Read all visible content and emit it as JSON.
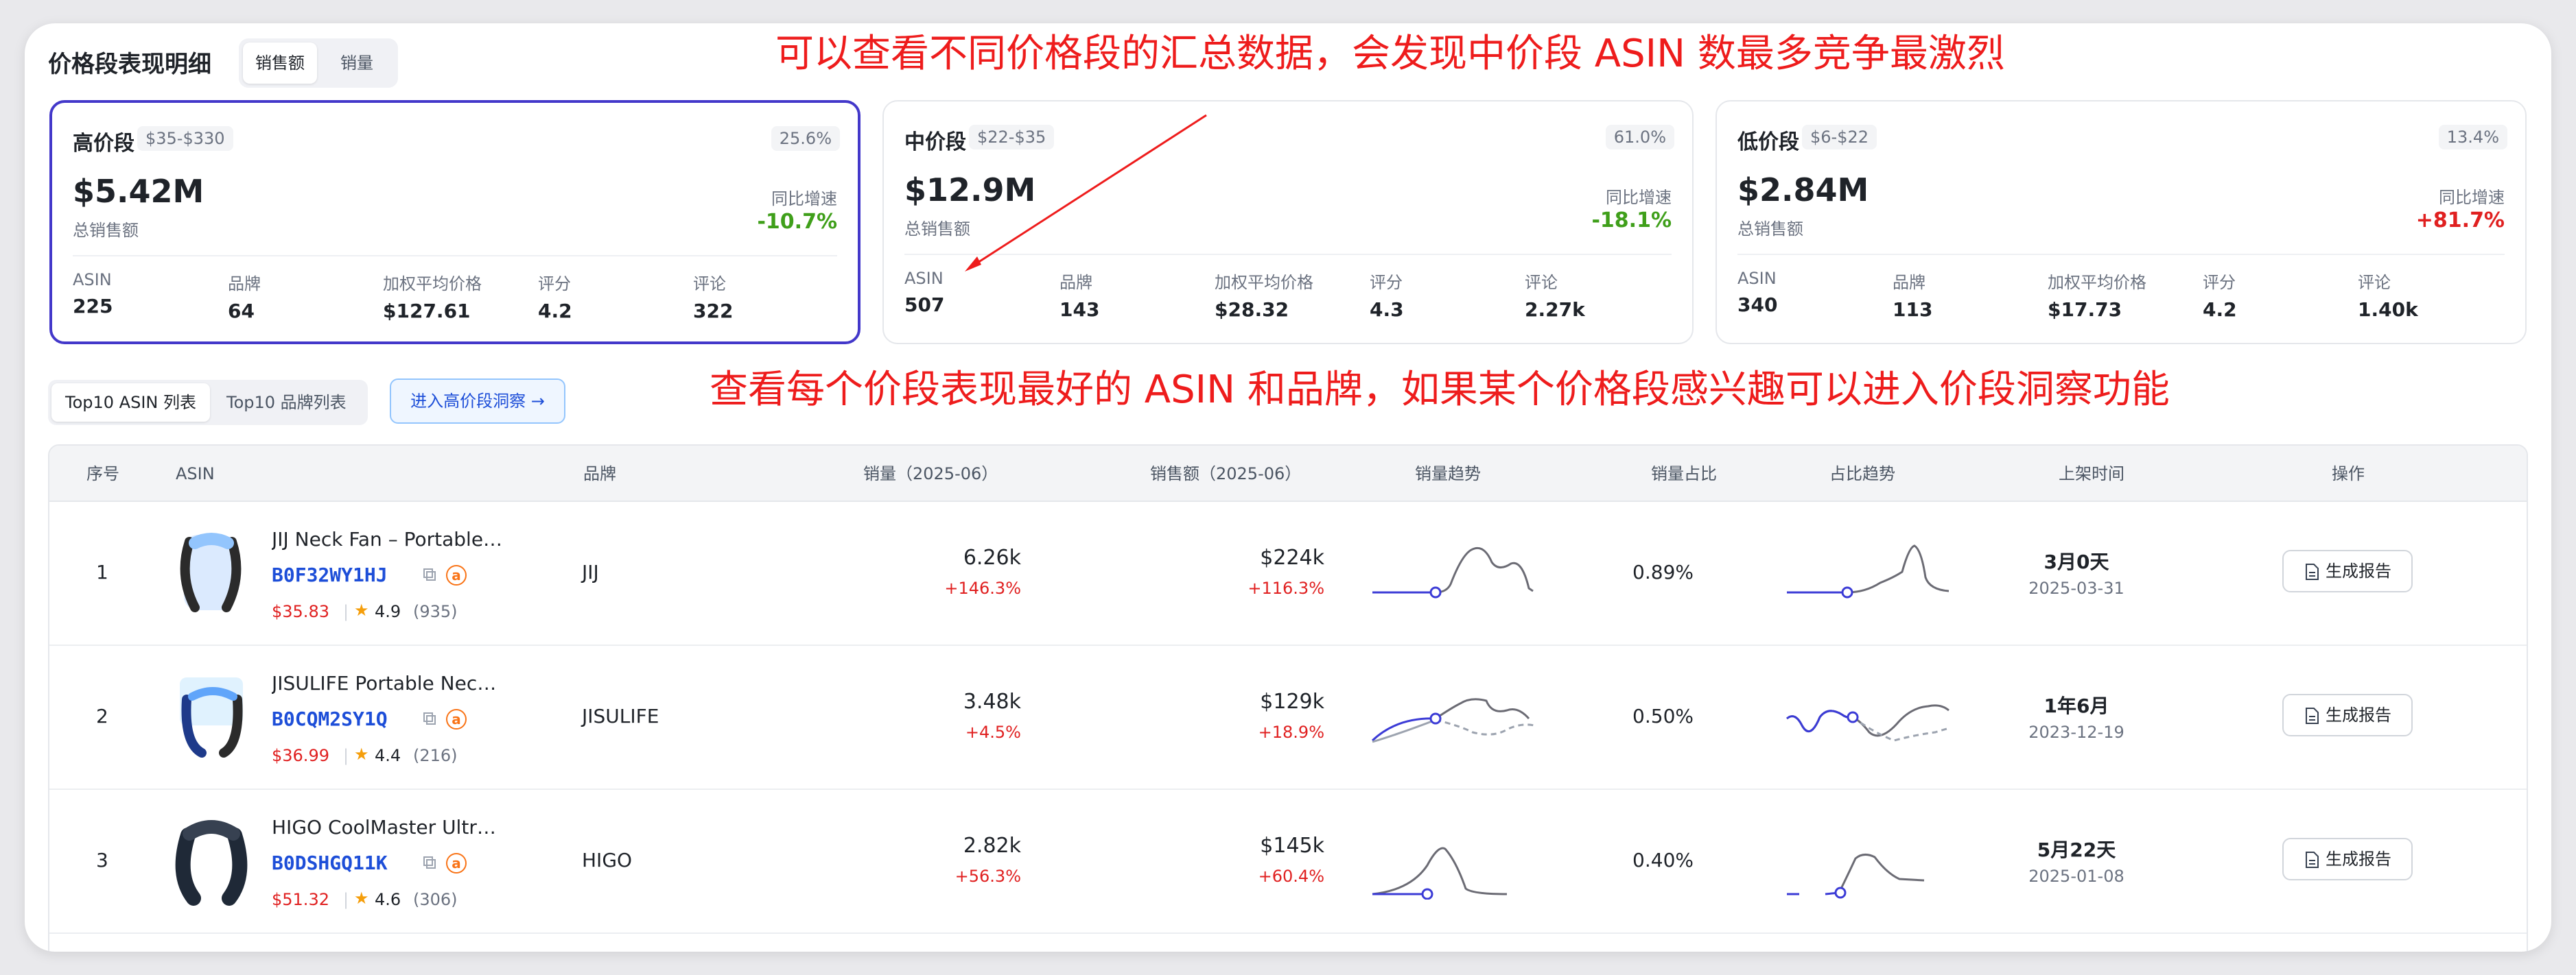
{
  "header": {
    "title": "价格段表现明细",
    "segment": [
      "销售额",
      "销量"
    ]
  },
  "annotations": {
    "top": "可以查看不同价格段的汇总数据，会发现中价段 ASIN 数最多竞争最激烈",
    "middle": "查看每个价段表现最好的 ASIN 和品牌，如果某个价格段感兴趣可以进入价段洞察功能"
  },
  "summary_label": "总销售额",
  "yoy_label": "同比增速",
  "metric_labels": [
    "ASIN",
    "品牌",
    "加权平均价格",
    "评分",
    "评论"
  ],
  "cards": [
    {
      "name": "高价段",
      "range": "$35-$330",
      "share": "25.6%",
      "total": "$5.42M",
      "yoy": "-10.7%",
      "asin": "225",
      "brand": "64",
      "price": "$127.61",
      "rating": "4.2",
      "reviews": "322"
    },
    {
      "name": "中价段",
      "range": "$22-$35",
      "share": "61.0%",
      "total": "$12.9M",
      "yoy": "-18.1%",
      "asin": "507",
      "brand": "143",
      "price": "$28.32",
      "rating": "4.3",
      "reviews": "2.27k"
    },
    {
      "name": "低价段",
      "range": "$6-$22",
      "share": "13.4%",
      "total": "$2.84M",
      "yoy": "+81.7%",
      "asin": "340",
      "brand": "113",
      "price": "$17.73",
      "rating": "4.2",
      "reviews": "1.40k"
    }
  ],
  "list_tabs": [
    "Top10 ASIN 列表",
    "Top10 品牌列表"
  ],
  "insight_button": "进入高价段洞察 →",
  "table": {
    "columns": [
      "序号",
      "ASIN",
      "品牌",
      "销量（2025-06）",
      "销售额（2025-06）",
      "销量趋势",
      "销量占比",
      "占比趋势",
      "上架时间",
      "操作"
    ],
    "action_label": "生成报告",
    "rows": [
      {
        "idx": "1",
        "title": "JIJ Neck Fan – Portable Bladeless",
        "asin": "B0F32WY1HJ",
        "price": "$35.83",
        "rating": "4.9",
        "reviews": "(935)",
        "brand": "JIJ",
        "volume": "6.26k",
        "volume_growth": "+146.3%",
        "sales": "$224k",
        "sales_growth": "+116.3%",
        "share": "0.89%",
        "age": "3月0天",
        "date": "2025-03-31"
      },
      {
        "idx": "2",
        "title": "JISULIFE Portable Neck Fan",
        "asin": "B0CQM2SY1Q",
        "price": "$36.99",
        "rating": "4.4",
        "reviews": "(216)",
        "brand": "JISULIFE",
        "volume": "3.48k",
        "volume_growth": "+4.5%",
        "sales": "$129k",
        "sales_growth": "+18.9%",
        "share": "0.50%",
        "age": "1年6月",
        "date": "2023-12-19"
      },
      {
        "idx": "3",
        "title": "HIGO CoolMaster Ultra Neck Fan",
        "asin": "B0DSHGQ11K",
        "price": "$51.32",
        "rating": "4.6",
        "reviews": "(306)",
        "brand": "HIGO",
        "volume": "2.82k",
        "volume_growth": "+56.3%",
        "sales": "$145k",
        "sales_growth": "+60.4%",
        "share": "0.40%",
        "age": "5月22天",
        "date": "2025-01-08"
      }
    ]
  },
  "colors": {
    "accent": "#4338ca",
    "red": "#e02020",
    "green": "#3f9f1a",
    "line": "#6b6b74",
    "blue_line": "#3b3bd6"
  }
}
